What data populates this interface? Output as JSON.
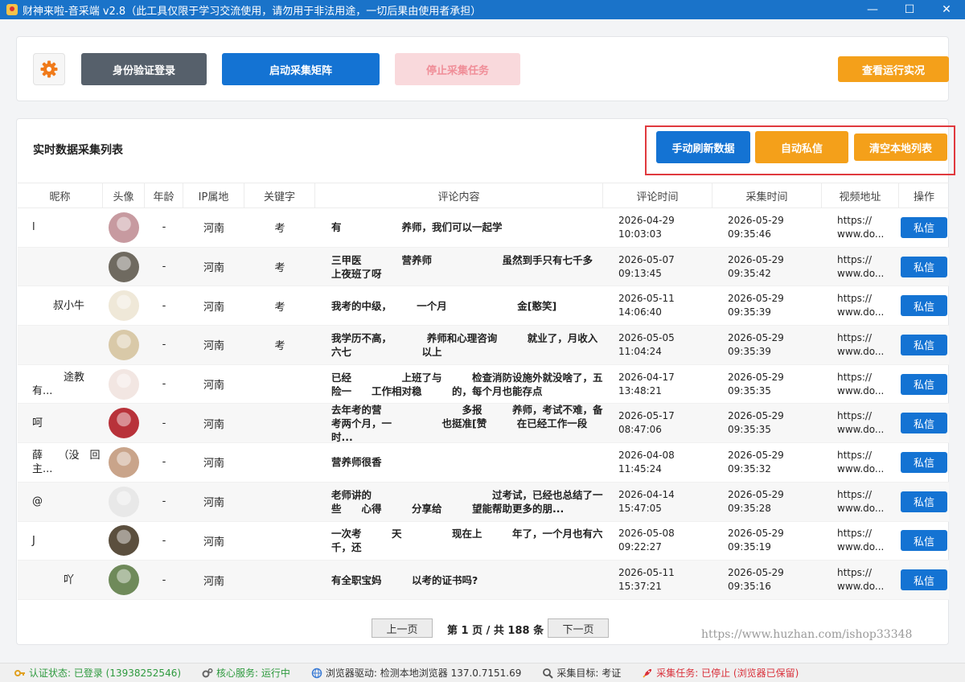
{
  "window": {
    "title": "财神来啦-音采端 v2.8（此工具仅限于学习交流使用，请勿用于非法用途，一切后果由使用者承担）",
    "minimize": "—",
    "maximize": "☐",
    "close": "✕"
  },
  "toolbar": {
    "auth_label": "身份验证登录",
    "start_label": "启动采集矩阵",
    "stop_label": "停止采集任务",
    "run_label": "查看运行实况"
  },
  "list": {
    "title": "实时数据采集列表",
    "refresh_label": "手动刷新数据",
    "auto_msg_label": "自动私信",
    "clear_label": "清空本地列表",
    "columns": [
      "昵称",
      "头像",
      "年龄",
      "IP属地",
      "关键字",
      "评论内容",
      "评论时间",
      "采集时间",
      "视频地址",
      "操作"
    ],
    "rows": [
      {
        "nick": "l",
        "age": "-",
        "ip": "河南",
        "kw": "考",
        "comment": "有　　　　　　养师，我们可以一起学",
        "comment_time": "2026-04-29 10:03:03",
        "collect_time": "2026-05-29 09:35:46",
        "video": "https:// www.do...",
        "action": "私信",
        "avatar": "#c79aa0"
      },
      {
        "nick": "",
        "age": "-",
        "ip": "河南",
        "kw": "考",
        "comment": "三甲医　　　　营养师　　　　　　　虽然到手只有七千多　　　　上夜班了呀",
        "comment_time": "2026-05-07 09:13:45",
        "collect_time": "2026-05-29 09:35:42",
        "video": "https:// www.do...",
        "action": "私信",
        "avatar": "#6f6a60"
      },
      {
        "nick": "　　叔小牛",
        "age": "-",
        "ip": "河南",
        "kw": "考",
        "comment": "我考的中级，　　　一个月　　　　　　　金[憨笑]",
        "comment_time": "2026-05-11 14:06:40",
        "collect_time": "2026-05-29 09:35:39",
        "video": "https:// www.do...",
        "action": "私信",
        "avatar": "#efe8d8"
      },
      {
        "nick": "",
        "age": "-",
        "ip": "河南",
        "kw": "考",
        "comment": "我学历不高，　　　　养师和心理咨询　　　就业了，月收入六七　　　　　　　以上",
        "comment_time": "2026-05-05 11:04:24",
        "collect_time": "2026-05-29 09:35:39",
        "video": "https:// www.do...",
        "action": "私信",
        "avatar": "#d9c9a8"
      },
      {
        "nick": "　　　途教　　　有...",
        "age": "-",
        "ip": "河南",
        "kw": "",
        "comment": "已经　　　　　上班了与　　　检查消防设施外就没啥了，五险一　　工作相对稳　　　的，每个月也能存点",
        "comment_time": "2026-04-17 13:48:21",
        "collect_time": "2026-05-29 09:35:35",
        "video": "https:// www.do...",
        "action": "私信",
        "avatar": "#f2e6e2"
      },
      {
        "nick": "呵",
        "age": "-",
        "ip": "河南",
        "kw": "",
        "comment": "去年考的营　　　　　　　　多报　　　养师，考试不难，备考两个月，一　　　　　也挺准[赞　　　在已经工作一段时...",
        "comment_time": "2026-05-17 08:47:06",
        "collect_time": "2026-05-29 09:35:35",
        "video": "https:// www.do...",
        "action": "私信",
        "avatar": "#b8323a"
      },
      {
        "nick": "薛　　（没　回　　　主...",
        "age": "-",
        "ip": "河南",
        "kw": "",
        "comment": "营养师很香",
        "comment_time": "2026-04-08 11:45:24",
        "collect_time": "2026-05-29 09:35:32",
        "video": "https:// www.do...",
        "action": "私信",
        "avatar": "#c9a48a"
      },
      {
        "nick": "@",
        "age": "-",
        "ip": "河南",
        "kw": "",
        "comment": "老师讲的　　　　　　　　　　　　过考试，已经也总结了一些　　心得　　　分享给　　　望能帮助更多的朋...",
        "comment_time": "2026-04-14 15:47:05",
        "collect_time": "2026-05-29 09:35:28",
        "video": "https:// www.do...",
        "action": "私信",
        "avatar": "#e8e8e8"
      },
      {
        "nick": "J",
        "age": "-",
        "ip": "河南",
        "kw": "",
        "comment": "一次考　　　天　　　　　现在上　　　年了，一个月也有六千，还　　　　",
        "comment_time": "2026-05-08 09:22:27",
        "collect_time": "2026-05-29 09:35:19",
        "video": "https:// www.do...",
        "action": "私信",
        "avatar": "#5b4f3e"
      },
      {
        "nick": "　　　吖",
        "age": "-",
        "ip": "河南",
        "kw": "",
        "comment": "有全职宝妈　　　以考的证书吗?",
        "comment_time": "2026-05-11 15:37:21",
        "collect_time": "2026-05-29 09:35:16",
        "video": "https:// www.do...",
        "action": "私信",
        "avatar": "#6f8a5a"
      }
    ]
  },
  "pager": {
    "prev_label": "上一页",
    "info": "第 1 页 / 共 188 条",
    "next_label": "下一页"
  },
  "watermark": "https://www.huzhan.com/ishop33348",
  "status": {
    "auth": "认证状态: 已登录 (13938252546)",
    "core": "核心服务: 运行中",
    "driver": "浏览器驱动: 检测本地浏览器 137.0.7151.69",
    "target": "采集目标: 考证",
    "task": "采集任务: 已停止 (浏览器已保留)"
  },
  "colors": {
    "titlebar": "#1a73c9",
    "primary": "#1473d3",
    "dark": "#56606b",
    "orange": "#f4a01a",
    "stop_bg": "#f9d9dc",
    "status_green": "#2e9a3e",
    "status_red": "#d9303a"
  }
}
